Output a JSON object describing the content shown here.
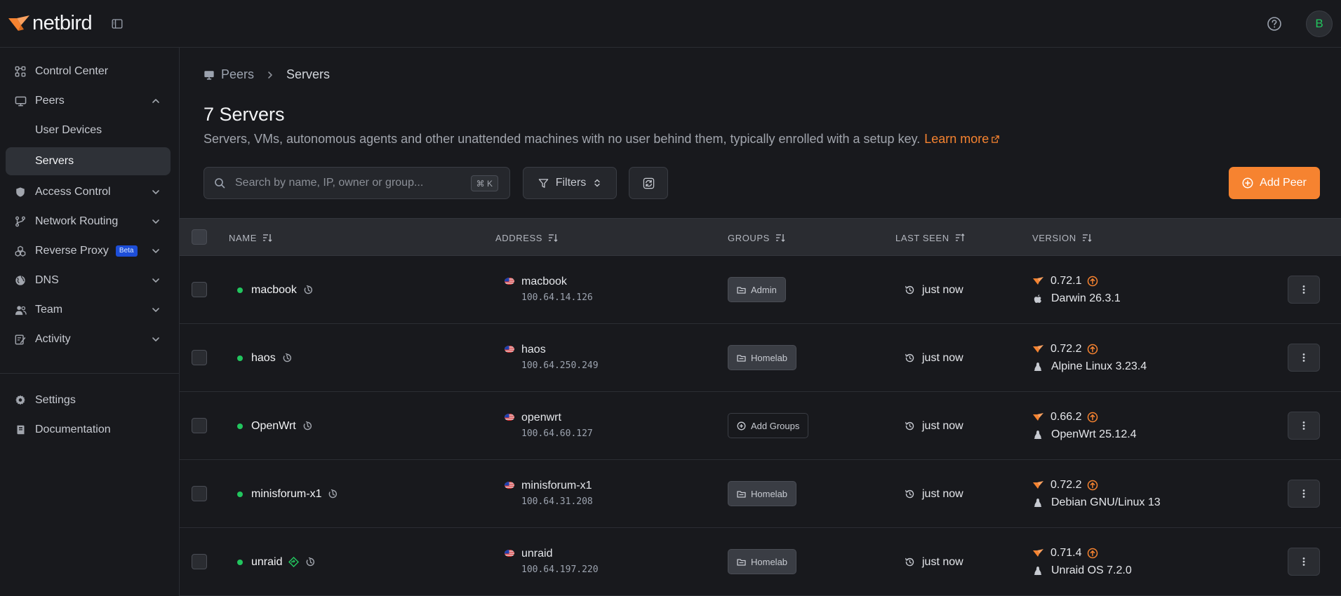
{
  "app": {
    "logo_text": "netbird",
    "avatar_initial": "B"
  },
  "colors": {
    "accent": "#f68330",
    "online": "#22c55e",
    "background": "#18191d",
    "badge_blue": "#1d4ed8"
  },
  "sidebar": {
    "items": [
      {
        "label": "Control Center",
        "icon": "control-center-icon"
      },
      {
        "label": "Peers",
        "icon": "monitor-icon",
        "expanded": true,
        "children": [
          {
            "label": "User Devices"
          },
          {
            "label": "Servers",
            "active": true
          }
        ]
      },
      {
        "label": "Access Control",
        "icon": "shield-icon"
      },
      {
        "label": "Network Routing",
        "icon": "network-routing-icon"
      },
      {
        "label": "Reverse Proxy",
        "icon": "reverse-proxy-icon",
        "badge": "Beta"
      },
      {
        "label": "DNS",
        "icon": "globe-icon"
      },
      {
        "label": "Team",
        "icon": "team-icon"
      },
      {
        "label": "Activity",
        "icon": "activity-icon"
      }
    ],
    "bottom": [
      {
        "label": "Settings",
        "icon": "gear-icon"
      },
      {
        "label": "Documentation",
        "icon": "book-icon"
      }
    ]
  },
  "breadcrumb": {
    "parent": "Peers",
    "current": "Servers"
  },
  "page": {
    "title": "7 Servers",
    "description": "Servers, VMs, autonomous agents and other unattended machines with no user behind them, typically enrolled with a setup key.",
    "learn_more": "Learn more"
  },
  "toolbar": {
    "search_placeholder": "Search by name, IP, owner or group...",
    "search_shortcut": "⌘ K",
    "filters_label": "Filters",
    "add_peer_label": "Add Peer"
  },
  "table": {
    "headers": {
      "name": "NAME",
      "address": "ADDRESS",
      "groups": "GROUPS",
      "last_seen": "LAST SEEN",
      "version": "VERSION"
    },
    "rows": [
      {
        "name": "macbook",
        "dns": "macbook",
        "ip": "100.64.14.126",
        "group": "Admin",
        "group_icon": "folder-icon",
        "last_seen": "just now",
        "version": "0.72.1",
        "os": "Darwin 26.3.1",
        "os_icon": "apple-icon",
        "routing": false
      },
      {
        "name": "haos",
        "dns": "haos",
        "ip": "100.64.250.249",
        "group": "Homelab",
        "group_icon": "folder-icon",
        "last_seen": "just now",
        "version": "0.72.2",
        "os": "Alpine Linux 3.23.4",
        "os_icon": "linux-icon",
        "routing": false
      },
      {
        "name": "OpenWrt",
        "dns": "openwrt",
        "ip": "100.64.60.127",
        "group": "Add Groups",
        "group_icon": "plus-circle-icon",
        "last_seen": "just now",
        "version": "0.66.2",
        "os": "OpenWrt 25.12.4",
        "os_icon": "linux-icon",
        "routing": false
      },
      {
        "name": "minisforum-x1",
        "dns": "minisforum-x1",
        "ip": "100.64.31.208",
        "group": "Homelab",
        "group_icon": "folder-icon",
        "last_seen": "just now",
        "version": "0.72.2",
        "os": "Debian GNU/Linux 13",
        "os_icon": "linux-icon",
        "routing": false
      },
      {
        "name": "unraid",
        "dns": "unraid",
        "ip": "100.64.197.220",
        "group": "Homelab",
        "group_icon": "folder-icon",
        "last_seen": "just now",
        "version": "0.71.4",
        "os": "Unraid OS 7.2.0",
        "os_icon": "linux-icon",
        "routing": true
      }
    ]
  }
}
